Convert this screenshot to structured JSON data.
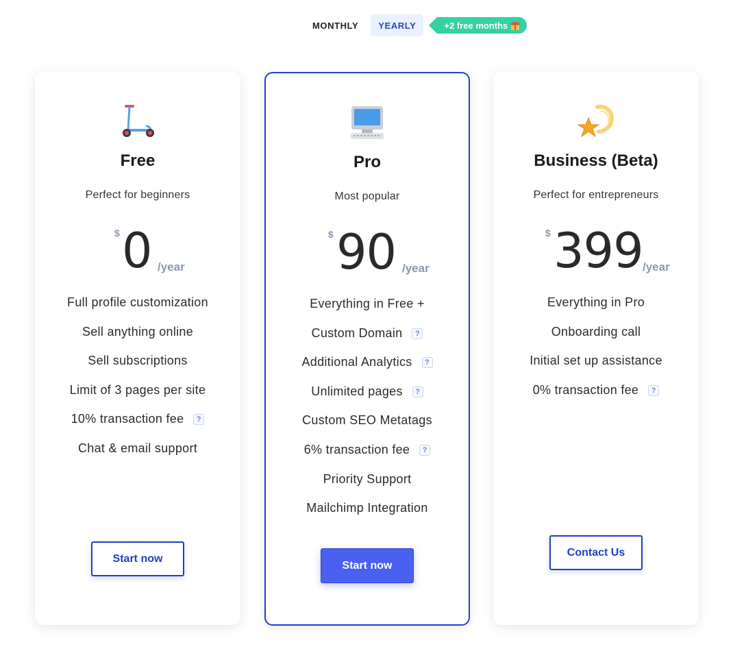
{
  "billing_toggle": {
    "monthly_label": "MONTHLY",
    "yearly_label": "YEARLY",
    "selected": "YEARLY",
    "promo_label": "+2 free months"
  },
  "plans": [
    {
      "icon": "kick-scooter-icon",
      "name": "Free",
      "tagline": "Perfect for beginners",
      "currency": "$",
      "price": "0",
      "period": "/year",
      "features": [
        {
          "text": "Full profile customization",
          "help": false
        },
        {
          "text": "Sell anything online",
          "help": false
        },
        {
          "text": "Sell subscriptions",
          "help": false
        },
        {
          "text": "Limit of 3 pages per site",
          "help": false
        },
        {
          "text": "10% transaction fee",
          "help": true
        },
        {
          "text": "Chat & email support",
          "help": false
        }
      ],
      "cta_label": "Start now"
    },
    {
      "icon": "desktop-computer-icon",
      "name": "Pro",
      "tagline": "Most popular",
      "currency": "$",
      "price": "90",
      "period": "/year",
      "features": [
        {
          "text": "Everything in Free +",
          "help": false
        },
        {
          "text": "Custom Domain",
          "help": true
        },
        {
          "text": "Additional Analytics",
          "help": true
        },
        {
          "text": "Unlimited pages",
          "help": true
        },
        {
          "text": "Custom SEO Metatags",
          "help": false
        },
        {
          "text": "6% transaction fee",
          "help": true
        },
        {
          "text": "Priority Support",
          "help": false
        },
        {
          "text": "Mailchimp Integration",
          "help": false
        }
      ],
      "cta_label": "Start now"
    },
    {
      "icon": "shooting-star-icon",
      "name": "Business (Beta)",
      "tagline": "Perfect for entrepreneurs",
      "currency": "$",
      "price": "399",
      "period": "/year",
      "features": [
        {
          "text": "Everything in Pro",
          "help": false
        },
        {
          "text": "Onboarding call",
          "help": false
        },
        {
          "text": "Initial set up assistance",
          "help": false
        },
        {
          "text": "0% transaction fee",
          "help": true
        }
      ],
      "cta_label": "Contact Us"
    }
  ],
  "help_glyph": "?",
  "colors": {
    "accent": "#1e3fc4",
    "primary_button": "#4960f0",
    "promo": "#34d1a3",
    "toggle_selected_bg": "#e9f0fe",
    "muted": "#8a97b5"
  }
}
